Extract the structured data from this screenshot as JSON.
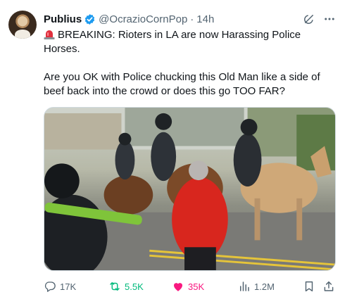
{
  "author": {
    "name": "Publius",
    "handle": "@OcrazioCornPop",
    "separator": "·",
    "time": "14h"
  },
  "tweet": {
    "line1": "BREAKING: Rioters in LA are now Harassing Police Horses.",
    "line2": "Are you OK with Police chucking this Old Man like a side of beef back into the crowd or does this go TOO FAR?"
  },
  "stats": {
    "replies": "17K",
    "reposts": "5.5K",
    "likes": "35K",
    "views": "1.2M"
  },
  "icons": {
    "verified": "verified-badge-icon",
    "grok": "grok-icon",
    "more": "more-icon",
    "siren": "siren-icon",
    "reply": "reply-icon",
    "repost": "repost-icon",
    "like": "heart-icon",
    "views": "views-chart-icon",
    "bookmark": "bookmark-icon",
    "share": "share-icon"
  },
  "colors": {
    "verified_blue": "#1d9bf0",
    "text": "#0f1419",
    "muted": "#536471",
    "repost_green": "#00ba7c",
    "like_pink": "#f91880"
  }
}
